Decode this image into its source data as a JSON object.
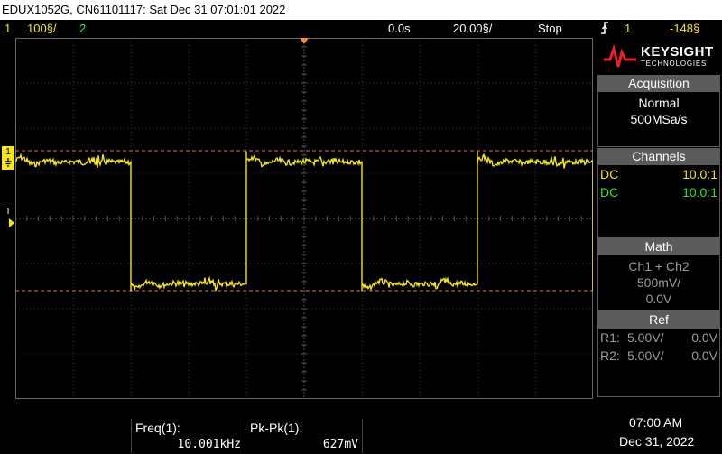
{
  "titlebar": {
    "text": "EDUX1052G, CN61101117: Sat Dec 31 07:01:01 2022"
  },
  "status": {
    "ch1_num": "1",
    "ch1_scale": "100§/",
    "ch2_num": "2",
    "time_delay": "0.0s",
    "time_scale": "20.00§/",
    "run_state": "Stop",
    "trig_icon": "trigger-edge-icon",
    "trig_src": "1",
    "trig_level": "-148§"
  },
  "brand": {
    "name": "KEYSIGHT",
    "sub": "TECHNOLOGIES",
    "icon": "keysight-logo-icon"
  },
  "acquisition": {
    "header": "Acquisition",
    "mode": "Normal",
    "rate": "500MSa/s"
  },
  "channels": {
    "header": "Channels",
    "rows": [
      {
        "coupling": "DC",
        "probe": "10.0:1",
        "color": "#f5e617"
      },
      {
        "coupling": "DC",
        "probe": "10.0:1",
        "color": "#2ee62e"
      }
    ]
  },
  "math": {
    "header": "Math",
    "expr": "Ch1 + Ch2",
    "scale": "500mV/",
    "offset": "0.0V"
  },
  "ref": {
    "header": "Ref",
    "rows": [
      {
        "label": "R1:",
        "scale": "5.00V/",
        "offset": "0.0V"
      },
      {
        "label": "R2:",
        "scale": "5.00V/",
        "offset": "0.0V"
      }
    ]
  },
  "measurements": [
    {
      "label": "Freq(1):",
      "value": "10.001kHz"
    },
    {
      "label": "Pk-Pk(1):",
      "value": "627mV"
    }
  ],
  "clock": {
    "time": "07:00 AM",
    "date": "Dec 31, 2022"
  },
  "markers": {
    "ground": "1",
    "trigger": "T"
  },
  "colors": {
    "ch1": "#f5e617",
    "ch2": "#2ee62e",
    "trigger": "#ff8c1a",
    "cursor": "#e0705a",
    "panel": "#5b5b5b"
  },
  "waveform": {
    "description_units": "divisions",
    "period_div": 4,
    "high_div": 1.25,
    "low_div": -1.45,
    "first_rise_div": 0.0,
    "first_fall_div": 2.0
  },
  "cursors": {
    "upper_div": 1.5,
    "lower_div": -1.6
  }
}
